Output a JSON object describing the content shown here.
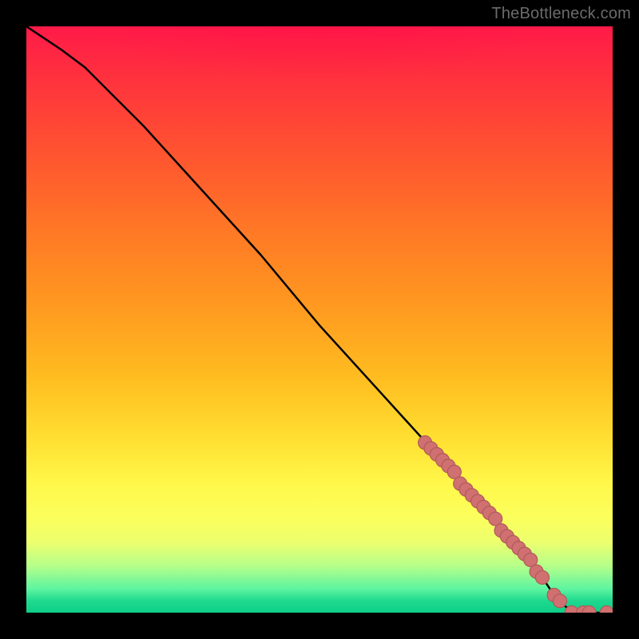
{
  "attribution": "TheBottleneck.com",
  "chart_data": {
    "type": "line",
    "title": "",
    "xlabel": "",
    "ylabel": "",
    "xlim": [
      0,
      100
    ],
    "ylim": [
      0,
      100
    ],
    "grid": false,
    "legend": false,
    "series": [
      {
        "name": "bottleneck-curve",
        "x": [
          0,
          3,
          6,
          10,
          15,
          20,
          30,
          40,
          50,
          60,
          70,
          78,
          84,
          88,
          90,
          92,
          94,
          96,
          98,
          100
        ],
        "y": [
          100,
          98,
          96,
          93,
          88,
          83,
          72,
          61,
          49,
          38,
          27,
          18,
          11,
          6,
          3,
          1,
          0,
          0,
          0,
          0
        ]
      }
    ],
    "markers": {
      "name": "highlighted-points",
      "x": [
        68,
        69,
        70,
        71,
        72,
        73,
        74,
        75,
        76,
        77,
        78,
        79,
        80,
        81,
        82,
        83,
        84,
        85,
        86,
        87,
        88,
        90,
        91,
        93,
        95,
        96,
        99
      ],
      "y": [
        29,
        28,
        27,
        26,
        25,
        24,
        22,
        21,
        20,
        19,
        18,
        17,
        16,
        14,
        13,
        12,
        11,
        10,
        9,
        7,
        6,
        3,
        2,
        0,
        0,
        0,
        0
      ]
    }
  },
  "colors": {
    "marker_fill": "#d07070",
    "marker_stroke": "#b05a5a",
    "curve": "#000000"
  }
}
